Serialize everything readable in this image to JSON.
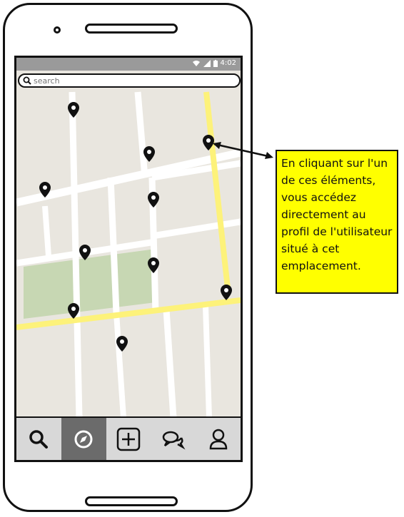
{
  "status_bar": {
    "time": "4:02",
    "wifi_icon": "wifi-icon",
    "signal_icon": "signal-icon",
    "battery_icon": "battery-icon"
  },
  "search": {
    "placeholder": "search",
    "icon": "search-icon"
  },
  "map": {
    "marker_icon": "map-pin-icon",
    "colors": {
      "background": "#e9e6df",
      "road": "#ffffff",
      "highway": "#fdf27a",
      "park": "#c7d7b3"
    }
  },
  "bottom_nav": {
    "items": [
      {
        "name": "search",
        "icon": "search-icon"
      },
      {
        "name": "explore",
        "icon": "compass-icon",
        "active": true
      },
      {
        "name": "add",
        "icon": "plus-square-icon"
      },
      {
        "name": "messages",
        "icon": "chat-icon"
      },
      {
        "name": "profile",
        "icon": "user-icon"
      }
    ]
  },
  "annotation": {
    "text": "En cliquant sur l'un de ces éléments, vous accédez directement au profil de l'utilisateur situé à cet emplacement.",
    "color": "#ffff00"
  }
}
